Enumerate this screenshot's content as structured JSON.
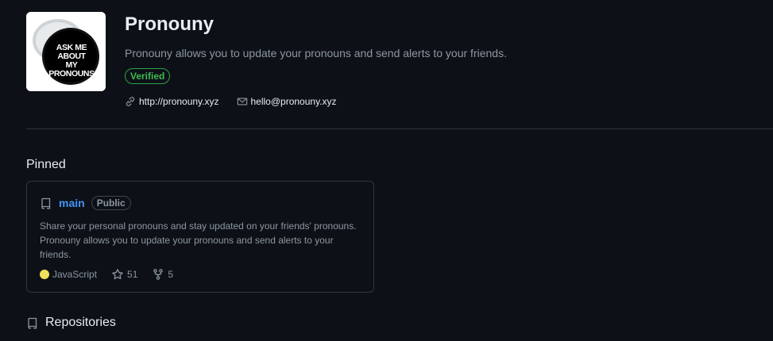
{
  "org": {
    "name": "Pronouny",
    "description": "Pronouny allows you to update your pronouns and send alerts to your friends.",
    "verified_label": "Verified",
    "avatar_text": [
      "ASK ME ABOUT",
      "MY PRONOUNS"
    ],
    "links": [
      {
        "icon": "link-icon",
        "text": "http://pronouny.xyz"
      },
      {
        "icon": "mail-icon",
        "text": "hello@pronouny.xyz"
      }
    ]
  },
  "pinned": {
    "title": "Pinned",
    "card": {
      "repo_name": "main",
      "visibility": "Public",
      "description": "Share your personal pronouns and stay updated on your friends' pronouns. Pronouny allows you to update your pronouns and send alerts to your friends.",
      "language": "JavaScript",
      "language_color": "#f1e05a",
      "stars": "51",
      "forks": "5"
    }
  },
  "repositories": {
    "title": "Repositories"
  },
  "colors": {
    "background": "#0d1117",
    "link": "#4493f8",
    "verified": "#3fb950",
    "muted": "#8d96a0",
    "border": "#30363d"
  }
}
